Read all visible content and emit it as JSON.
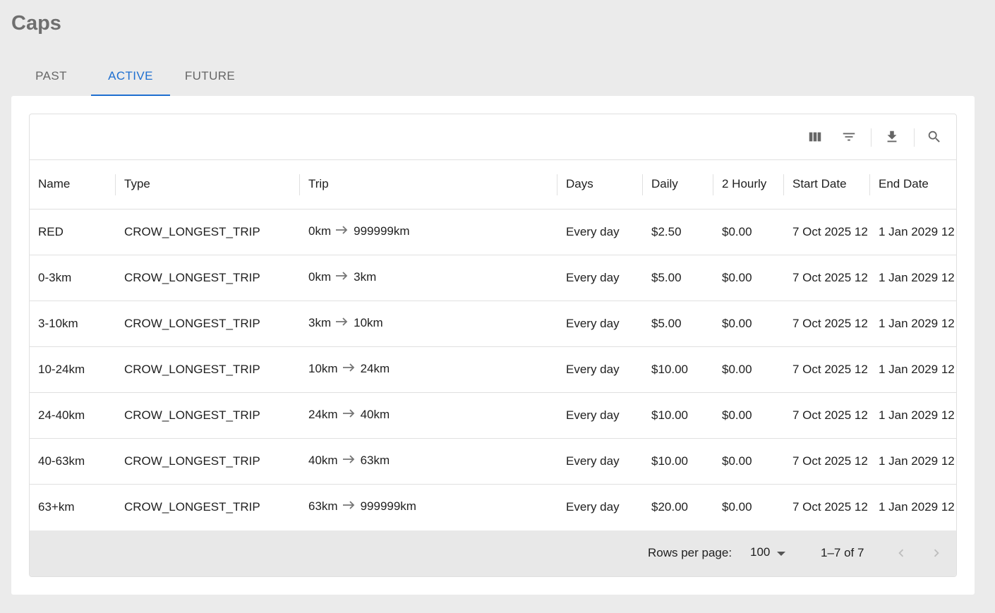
{
  "page": {
    "title": "Caps"
  },
  "tabs": [
    {
      "label": "PAST",
      "active": false
    },
    {
      "label": "ACTIVE",
      "active": true
    },
    {
      "label": "FUTURE",
      "active": false
    }
  ],
  "toolbar": {
    "icons": [
      "view-columns-icon",
      "filter-icon",
      "download-icon",
      "search-icon"
    ]
  },
  "table": {
    "columns": [
      "Name",
      "Type",
      "Trip",
      "Days",
      "Daily",
      "2 Hourly",
      "Start Date",
      "End Date"
    ],
    "rows": [
      {
        "name": "RED",
        "type": "CROW_LONGEST_TRIP",
        "trip_from": "0km",
        "trip_to": "999999km",
        "days": "Every day",
        "daily": "$2.50",
        "hourly2": "$0.00",
        "start": "7 Oct 2025 12",
        "end": "1 Jan 2029 12"
      },
      {
        "name": "0-3km",
        "type": "CROW_LONGEST_TRIP",
        "trip_from": "0km",
        "trip_to": "3km",
        "days": "Every day",
        "daily": "$5.00",
        "hourly2": "$0.00",
        "start": "7 Oct 2025 12",
        "end": "1 Jan 2029 12"
      },
      {
        "name": "3-10km",
        "type": "CROW_LONGEST_TRIP",
        "trip_from": "3km",
        "trip_to": "10km",
        "days": "Every day",
        "daily": "$5.00",
        "hourly2": "$0.00",
        "start": "7 Oct 2025 12",
        "end": "1 Jan 2029 12"
      },
      {
        "name": "10-24km",
        "type": "CROW_LONGEST_TRIP",
        "trip_from": "10km",
        "trip_to": "24km",
        "days": "Every day",
        "daily": "$10.00",
        "hourly2": "$0.00",
        "start": "7 Oct 2025 12",
        "end": "1 Jan 2029 12"
      },
      {
        "name": "24-40km",
        "type": "CROW_LONGEST_TRIP",
        "trip_from": "24km",
        "trip_to": "40km",
        "days": "Every day",
        "daily": "$10.00",
        "hourly2": "$0.00",
        "start": "7 Oct 2025 12",
        "end": "1 Jan 2029 12"
      },
      {
        "name": "40-63km",
        "type": "CROW_LONGEST_TRIP",
        "trip_from": "40km",
        "trip_to": "63km",
        "days": "Every day",
        "daily": "$10.00",
        "hourly2": "$0.00",
        "start": "7 Oct 2025 12",
        "end": "1 Jan 2029 12"
      },
      {
        "name": "63+km",
        "type": "CROW_LONGEST_TRIP",
        "trip_from": "63km",
        "trip_to": "999999km",
        "days": "Every day",
        "daily": "$20.00",
        "hourly2": "$0.00",
        "start": "7 Oct 2025 12",
        "end": "1 Jan 2029 12"
      }
    ]
  },
  "pagination": {
    "rows_per_page_label": "Rows per page:",
    "rows_per_page_value": "100",
    "range": "1–7 of 7"
  },
  "colors": {
    "accent": "#1e6fd0",
    "background": "#ebebeb"
  }
}
